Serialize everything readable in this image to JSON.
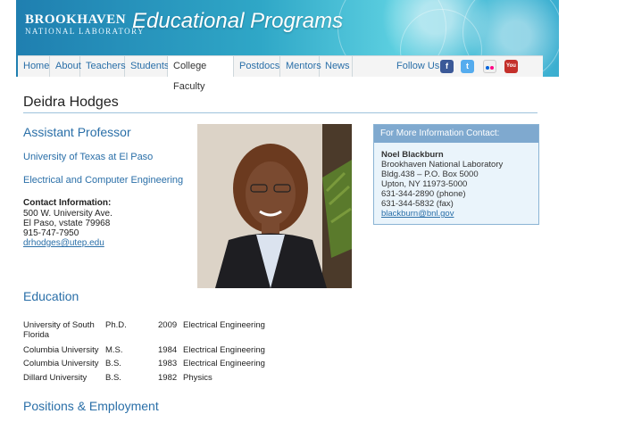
{
  "banner": {
    "logo_line1": "BROOKHAVEN",
    "logo_line2": "NATIONAL LABORATORY",
    "title": "Educational Programs"
  },
  "nav": {
    "items": [
      "Home",
      "About",
      "Teachers",
      "Students",
      "College Faculty",
      "Postdocs",
      "Mentors",
      "News"
    ],
    "active": "College Faculty",
    "follow_label": "Follow Us",
    "social_icons": [
      "facebook-icon",
      "twitter-icon",
      "flickr-icon",
      "youtube-icon"
    ]
  },
  "profile": {
    "name": "Deidra Hodges",
    "title": "Assistant Professor",
    "institution": "University of Texas at El Paso",
    "department": "Electrical and Computer Engineering",
    "contact_label": "Contact Information",
    "address1": "500 W. University Ave.",
    "address2": "El Paso, vstate 79968",
    "phone": "915-747-7950",
    "email": "drhodges@utep.edu"
  },
  "contact_box": {
    "heading": "For More Information Contact:",
    "name": "Noel Blackburn",
    "org": "Brookhaven National Laboratory",
    "bldg": "Bldg.438 – P.O. Box 5000",
    "city": "Upton, NY 11973-5000",
    "phone": "631-344-2890 (phone)",
    "fax": "631-344-5832 (fax)",
    "email": "blackburn@bnl.gov"
  },
  "education": {
    "heading": "Education",
    "rows": [
      {
        "school": "University of South Florida",
        "degree": "Ph.D.",
        "year": "2009",
        "field": "Electrical Engineering"
      },
      {
        "school": "Columbia University",
        "degree": "M.S.",
        "year": "1984",
        "field": "Electrical Engineering"
      },
      {
        "school": "Columbia University",
        "degree": "B.S.",
        "year": "1983",
        "field": "Electrical Engineering"
      },
      {
        "school": "Dillard University",
        "degree": "B.S.",
        "year": "1982",
        "field": "Physics"
      }
    ]
  },
  "positions": {
    "heading": "Positions & Employment"
  }
}
